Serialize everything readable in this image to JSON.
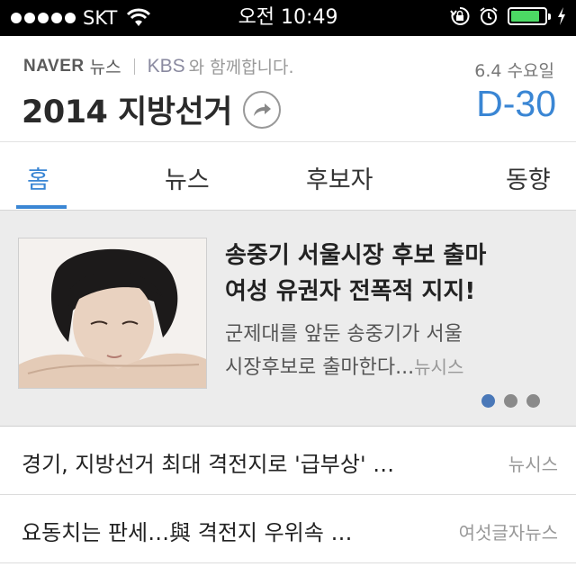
{
  "status_bar": {
    "carrier": "SKT",
    "time": "오전 10:49",
    "battery_level": 0.85,
    "battery_color": "#4cd964"
  },
  "header": {
    "naver_logo": "NAVER",
    "naver_section": "뉴스",
    "partner_logo": "KBS",
    "partner_text": "와 함께합니다.",
    "title": "2014 지방선거",
    "election_date": "6.4 수요일",
    "dday": "D-30",
    "share_icon": "share-arrow-icon",
    "accent_color": "#3a86d4"
  },
  "tabs": [
    {
      "label": "홈",
      "active": true
    },
    {
      "label": "뉴스",
      "active": false
    },
    {
      "label": "후보자",
      "active": false
    },
    {
      "label": "동향",
      "active": false
    }
  ],
  "featured": {
    "headline_line1": "송중기 서울시장 후보 출마",
    "headline_line2": "여성 유권자 전폭적 지지!",
    "summary_line1": "군제대를 앞둔 송중기가 서울",
    "summary_line2": "시장후보로 출마한다...",
    "source": "뉴시스",
    "pager": {
      "count": 3,
      "active_index": 0
    }
  },
  "news_list": [
    {
      "title": "경기, 지방선거 최대 격전지로 '급부상' …",
      "source": "뉴시스"
    },
    {
      "title": "요동치는 판세…與 격전지 우위속 …",
      "source": "여섯글자뉴스"
    }
  ]
}
